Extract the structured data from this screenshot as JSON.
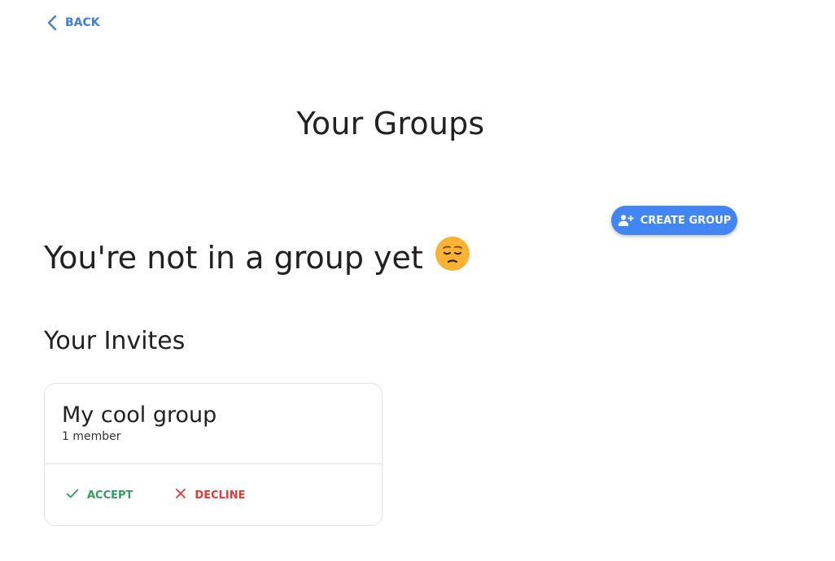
{
  "nav": {
    "back_label": "BACK",
    "back_icon": "chevron-left-icon"
  },
  "page": {
    "title": "Your Groups"
  },
  "toolbar": {
    "create_group_label": "CREATE GROUP",
    "create_group_icon": "person-add-icon",
    "accent_color": "#4285f4"
  },
  "empty_state": {
    "message": "You're not in a group yet",
    "emoji": "😔"
  },
  "invites": {
    "heading": "Your Invites",
    "items": [
      {
        "group_name": "My cool group",
        "member_count": "1 member",
        "accept_label": "ACCEPT",
        "decline_label": "DECLINE"
      }
    ]
  },
  "colors": {
    "back_link": "#3f7fe0",
    "accept": "#2e9f5e",
    "decline": "#e53935"
  }
}
